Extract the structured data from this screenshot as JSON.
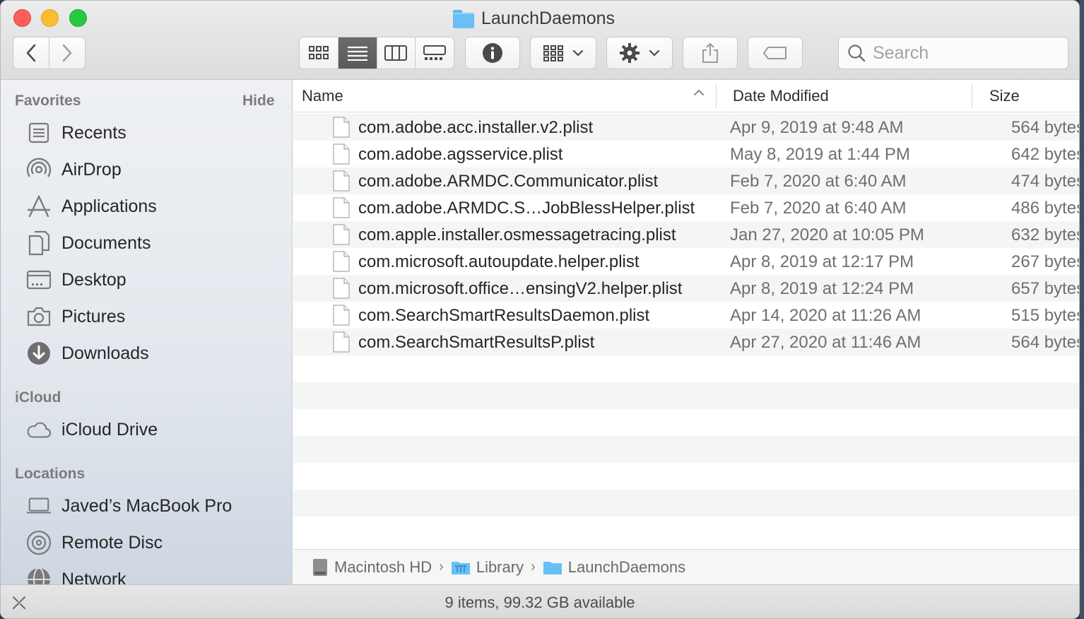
{
  "window": {
    "title": "LaunchDaemons"
  },
  "toolbar": {
    "back_glyph": "‹",
    "forward_glyph": "›",
    "view_modes": [
      "icon-view",
      "list-view",
      "column-view",
      "gallery-view"
    ],
    "active_view": "list-view",
    "search_placeholder": "Search",
    "search_value": ""
  },
  "sidebar": {
    "favorites_label": "Favorites",
    "hide_label": "Hide",
    "favorites": [
      {
        "label": "Recents",
        "icon": "recents-icon"
      },
      {
        "label": "AirDrop",
        "icon": "airdrop-icon"
      },
      {
        "label": "Applications",
        "icon": "applications-icon"
      },
      {
        "label": "Documents",
        "icon": "documents-icon"
      },
      {
        "label": "Desktop",
        "icon": "desktop-icon"
      },
      {
        "label": "Pictures",
        "icon": "pictures-icon"
      },
      {
        "label": "Downloads",
        "icon": "downloads-icon"
      }
    ],
    "icloud_label": "iCloud",
    "icloud": [
      {
        "label": "iCloud Drive",
        "icon": "cloud-icon"
      }
    ],
    "locations_label": "Locations",
    "locations": [
      {
        "label": "Javed’s MacBook Pro",
        "icon": "laptop-icon"
      },
      {
        "label": "Remote Disc",
        "icon": "disc-icon"
      },
      {
        "label": "Network",
        "icon": "network-icon"
      }
    ]
  },
  "columns": {
    "name": "Name",
    "date": "Date Modified",
    "size": "Size"
  },
  "files": [
    {
      "name": "com.adobe.acc.installer.v2.plist",
      "date": "Apr 9, 2019 at 9:48 AM",
      "size": "564 bytes"
    },
    {
      "name": "com.adobe.agsservice.plist",
      "date": "May 8, 2019 at 1:44 PM",
      "size": "642 bytes"
    },
    {
      "name": "com.adobe.ARMDC.Communicator.plist",
      "date": "Feb 7, 2020 at 6:40 AM",
      "size": "474 bytes"
    },
    {
      "name": "com.adobe.ARMDC.S…JobBlessHelper.plist",
      "date": "Feb 7, 2020 at 6:40 AM",
      "size": "486 bytes"
    },
    {
      "name": "com.apple.installer.osmessagetracing.plist",
      "date": "Jan 27, 2020 at 10:05 PM",
      "size": "632 bytes"
    },
    {
      "name": "com.microsoft.autoupdate.helper.plist",
      "date": "Apr 8, 2019 at 12:17 PM",
      "size": "267 bytes"
    },
    {
      "name": "com.microsoft.office…ensingV2.helper.plist",
      "date": "Apr 8, 2019 at 12:24 PM",
      "size": "657 bytes"
    },
    {
      "name": "com.SearchSmartResultsDaemon.plist",
      "date": "Apr 14, 2020 at 11:26 AM",
      "size": "515 bytes"
    },
    {
      "name": "com.SearchSmartResultsP.plist",
      "date": "Apr 27, 2020 at 11:46 AM",
      "size": "564 bytes"
    }
  ],
  "path": [
    "Macintosh HD",
    "Library",
    "LaunchDaemons"
  ],
  "status": {
    "text": "9 items, 99.32 GB available"
  },
  "colors": {
    "accent": "#69c0f4",
    "active_segment": "#5e5e5e",
    "row_alt": "#f4f5f5"
  }
}
